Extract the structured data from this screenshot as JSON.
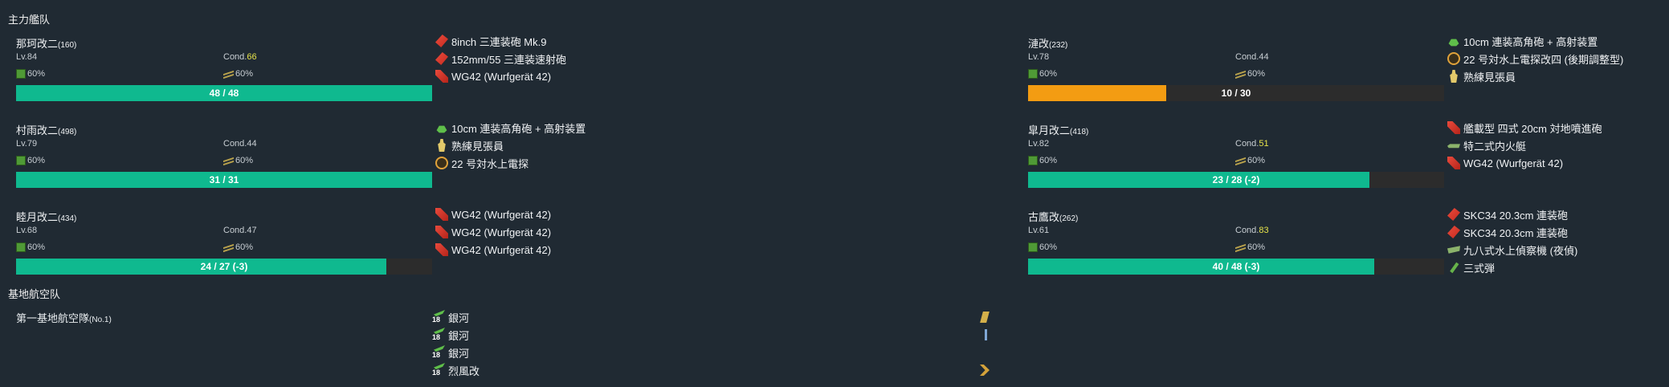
{
  "sections": {
    "main_fleet": "主力艦队",
    "lbas": "基地航空队"
  },
  "ships": [
    {
      "name": "那珂改二",
      "id": "(160)",
      "lv": "Lv.84",
      "cond_label": "Cond.",
      "cond": "66",
      "fuel": "60%",
      "ammo": "60%",
      "hp": "48 / 48",
      "hp_frac": 1.0,
      "hp_color": "#0fb98f",
      "equip": [
        {
          "icon": "gun-red",
          "label": "8inch 三連装砲 Mk.9"
        },
        {
          "icon": "gun-red",
          "label": "152mm/55 三連装速射砲"
        },
        {
          "icon": "rocket",
          "label": "WG42 (Wurfgerät 42)"
        }
      ]
    },
    {
      "name": "村雨改二",
      "id": "(498)",
      "lv": "Lv.79",
      "cond_label": "Cond.",
      "cond": "44",
      "fuel": "60%",
      "ammo": "60%",
      "hp": "31 / 31",
      "hp_frac": 1.0,
      "hp_color": "#0fb98f",
      "equip": [
        {
          "icon": "aa-green",
          "label": "10cm 連装高角砲 + 高射装置"
        },
        {
          "icon": "lookout",
          "label": "熟練見張員"
        },
        {
          "icon": "radar",
          "label": "22 号対水上電探"
        }
      ]
    },
    {
      "name": "睦月改二",
      "id": "(434)",
      "lv": "Lv.68",
      "cond_label": "Cond.",
      "cond": "47",
      "fuel": "60%",
      "ammo": "60%",
      "hp": "24 / 27 (-3)",
      "hp_frac": 0.889,
      "hp_color": "#0fb98f",
      "equip": [
        {
          "icon": "rocket",
          "label": "WG42 (Wurfgerät 42)"
        },
        {
          "icon": "rocket",
          "label": "WG42 (Wurfgerät 42)"
        },
        {
          "icon": "rocket",
          "label": "WG42 (Wurfgerät 42)"
        }
      ]
    },
    {
      "name": "漣改",
      "id": "(232)",
      "lv": "Lv.78",
      "cond_label": "Cond.",
      "cond": "44",
      "fuel": "60%",
      "ammo": "60%",
      "hp": "10 / 30",
      "hp_frac": 0.333,
      "hp_color": "#f39c12",
      "equip": [
        {
          "icon": "aa-green",
          "label": "10cm 連装高角砲 + 高射装置"
        },
        {
          "icon": "radar",
          "label": "22 号対水上電探改四 (後期調整型)"
        },
        {
          "icon": "lookout",
          "label": "熟練見張員"
        }
      ]
    },
    {
      "name": "皐月改二",
      "id": "(418)",
      "lv": "Lv.82",
      "cond_label": "Cond.",
      "cond": "51",
      "fuel": "60%",
      "ammo": "60%",
      "hp": "23 / 28 (-2)",
      "hp_frac": 0.821,
      "hp_color": "#0fb98f",
      "equip": [
        {
          "icon": "rocket",
          "label": "艦載型 四式 20cm 対地噴進砲"
        },
        {
          "icon": "sub",
          "label": "特二式内火艇"
        },
        {
          "icon": "rocket",
          "label": "WG42 (Wurfgerät 42)"
        }
      ]
    },
    {
      "name": "古鷹改",
      "id": "(262)",
      "lv": "Lv.61",
      "cond_label": "Cond.",
      "cond": "83",
      "fuel": "60%",
      "ammo": "60%",
      "hp": "40 / 48 (-3)",
      "hp_frac": 0.833,
      "hp_color": "#0fb98f",
      "equip": [
        {
          "icon": "gun-red",
          "label": "SKC34 20.3cm 連装砲"
        },
        {
          "icon": "gun-red",
          "label": "SKC34 20.3cm 連装砲"
        },
        {
          "icon": "seaplane",
          "label": "九八式水上偵察機 (夜偵)"
        },
        {
          "icon": "shell",
          "label": "三式弾"
        }
      ]
    }
  ],
  "lbas": {
    "name": "第一基地航空隊",
    "id": "(No.1)",
    "slots": [
      {
        "count": "18",
        "label": "銀河",
        "prof_color": "#d4b04a"
      },
      {
        "count": "18",
        "label": "銀河",
        "prof_color": "#7fa7d6"
      },
      {
        "count": "18",
        "label": "銀河",
        "prof_color": ""
      },
      {
        "count": "18",
        "label": "烈風改",
        "prof_color": "#d4a23a"
      }
    ]
  },
  "colors": {
    "bg": "#202a33",
    "hp_green": "#0fb98f",
    "hp_orange": "#f39c12",
    "cond_sparkle": "#e6e34a"
  }
}
